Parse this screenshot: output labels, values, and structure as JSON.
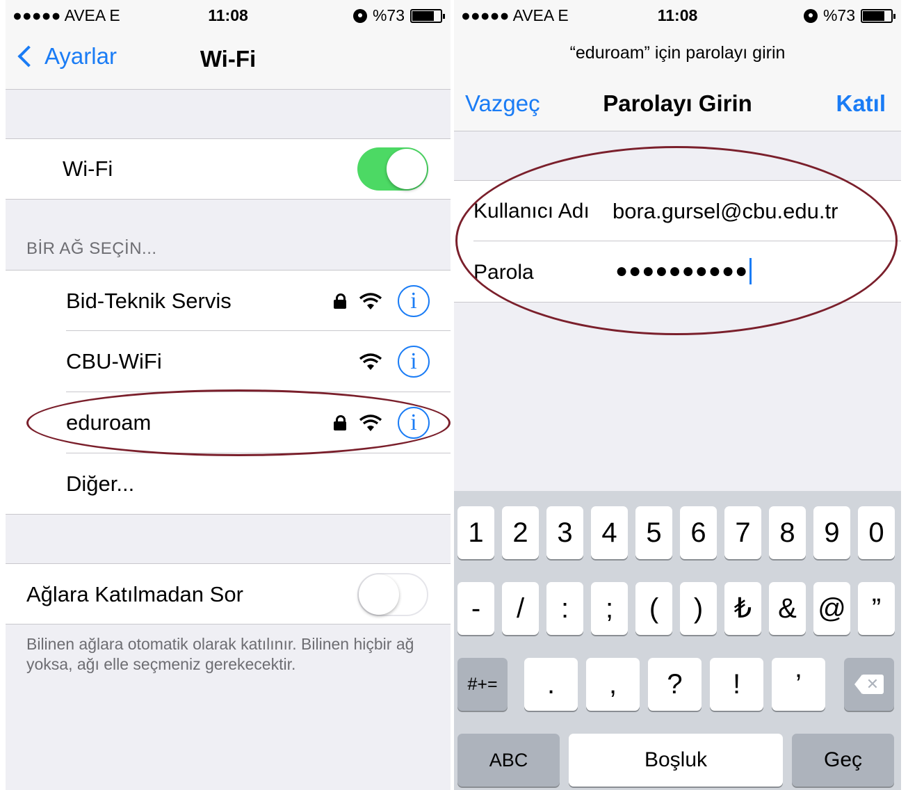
{
  "left": {
    "status": {
      "carrier": "●●●●● AVEA  E",
      "time": "11:08",
      "battery": "%73",
      "battery_level": 0.73
    },
    "nav": {
      "back_label": "Ayarlar",
      "title": "Wi-Fi"
    },
    "wifi_row": {
      "label": "Wi-Fi",
      "enabled": true
    },
    "section_header": "BİR AĞ SEÇİN...",
    "networks": [
      {
        "name": "Bid-Teknik Servis",
        "locked": true,
        "info": "i"
      },
      {
        "name": "CBU-WiFi",
        "locked": false,
        "info": "i"
      },
      {
        "name": "eduroam",
        "locked": true,
        "info": "i"
      },
      {
        "name": "Diğer..."
      }
    ],
    "ask_row": {
      "label": "Ağlara Katılmadan Sor",
      "enabled": false
    },
    "footer_note": "Bilinen ağlara otomatik olarak katılınır. Bilinen hiçbir ağ yoksa, ağı elle seçmeniz gerekecektir."
  },
  "right": {
    "status": {
      "carrier": "●●●●● AVEA  E",
      "time": "11:08",
      "battery": "%73",
      "battery_level": 0.73
    },
    "prompt": "“eduroam” için parolayı girin",
    "nav": {
      "cancel_label": "Vazgeç",
      "title": "Parolayı Girin",
      "join_label": "Katıl"
    },
    "form": {
      "username_label": "Kullanıcı Adı",
      "username_value": "bora.gursel@cbu.edu.tr",
      "password_label": "Parola",
      "password_value": "●●●●●●●●●●"
    },
    "keyboard": {
      "row1": [
        "1",
        "2",
        "3",
        "4",
        "5",
        "6",
        "7",
        "8",
        "9",
        "0"
      ],
      "row2": [
        "-",
        "/",
        ":",
        ";",
        "(",
        ")",
        "₺",
        "&",
        "@",
        "”"
      ],
      "row3": [
        ".",
        ",",
        "?",
        "!",
        "’"
      ],
      "symbols_key": "#+=",
      "abc_key": "ABC",
      "space_key": "Boşluk",
      "go_key": "Geç",
      "backspace_icon": "backspace-icon"
    }
  },
  "colors": {
    "accent": "#1a7cf5",
    "toggle_on": "#4cd964",
    "annotation": "#7a1f2b"
  }
}
